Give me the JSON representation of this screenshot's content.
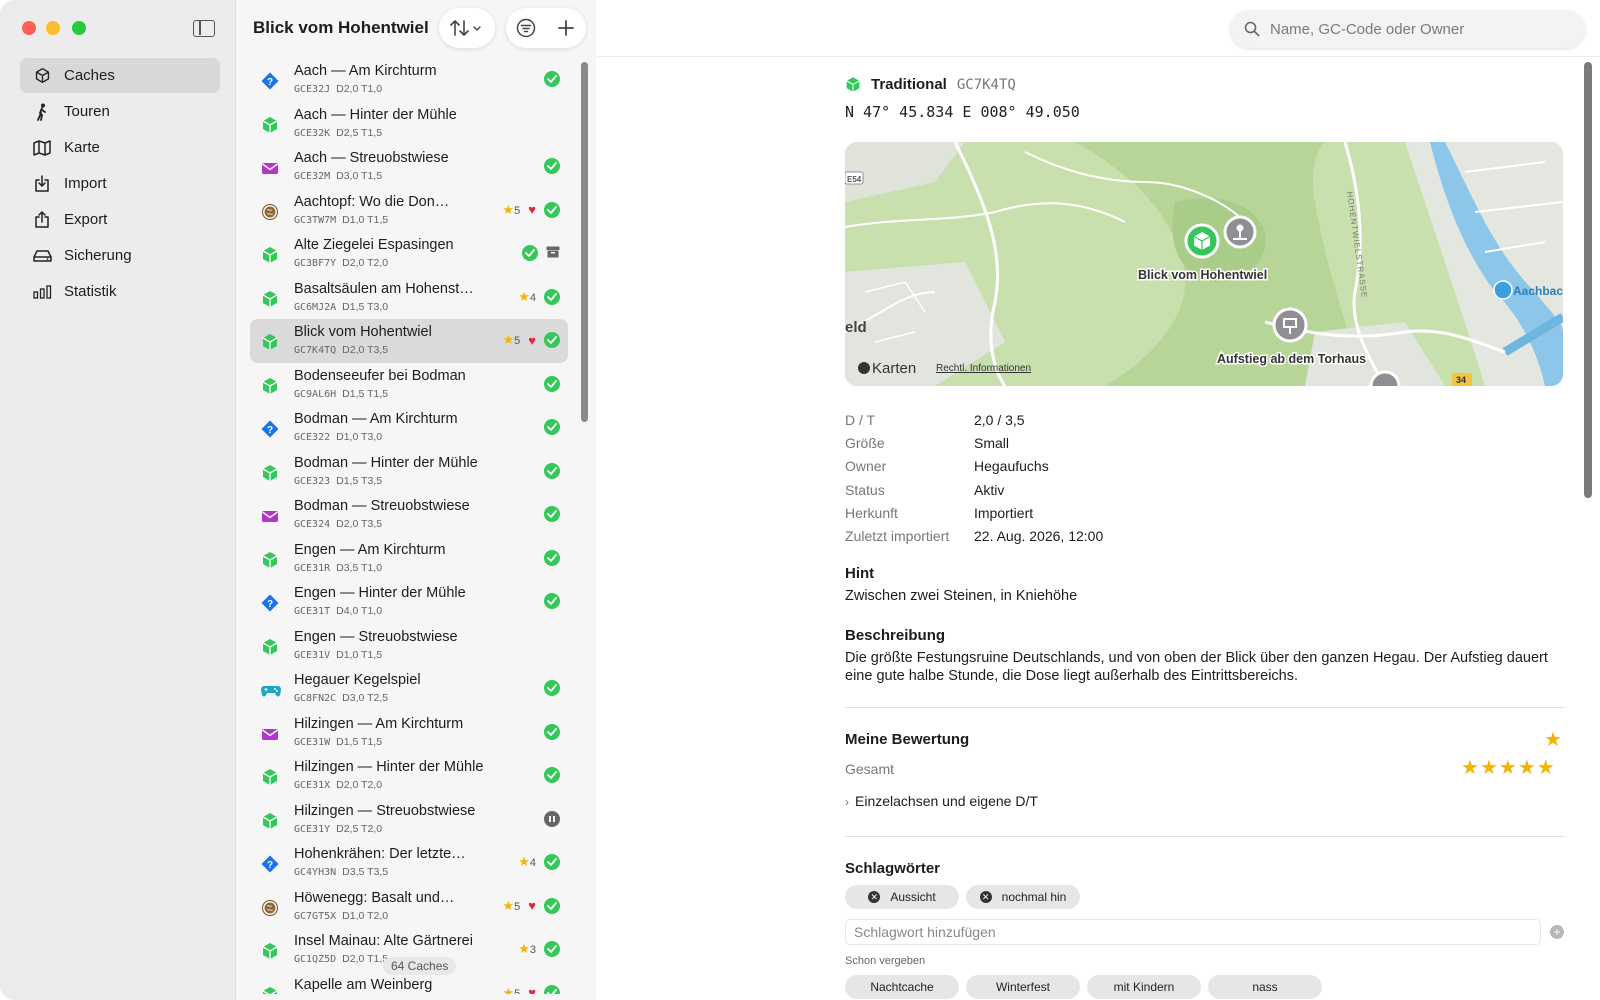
{
  "sidebar": {
    "items": [
      {
        "label": "Caches",
        "icon": "cube-icon"
      },
      {
        "label": "Touren",
        "icon": "hiker-icon"
      },
      {
        "label": "Karte",
        "icon": "map-icon"
      },
      {
        "label": "Import",
        "icon": "import-icon"
      },
      {
        "label": "Export",
        "icon": "export-icon"
      },
      {
        "label": "Sicherung",
        "icon": "drive-icon"
      },
      {
        "label": "Statistik",
        "icon": "chart-icon"
      }
    ]
  },
  "list": {
    "title": "Blick vom Hohentwiel",
    "count_label": "64 Caches",
    "items": [
      {
        "name": "Aach — Am Kirchturm",
        "code": "GCE32J",
        "dt": "D2,0 T1,0",
        "type": "mystery",
        "status": "found"
      },
      {
        "name": "Aach — Hinter der Mühle",
        "code": "GCE32K",
        "dt": "D2,5 T1,5",
        "type": "traditional",
        "status": "none"
      },
      {
        "name": "Aach — Streuobstwiese",
        "code": "GCE32M",
        "dt": "D3,0 T1,5",
        "type": "letterbox",
        "status": "found"
      },
      {
        "name": "Aachtopf: Wo die Don…",
        "code": "GC3TW7M",
        "dt": "D1,0 T1,5",
        "type": "earth",
        "stars": "5",
        "fav": true,
        "status": "found"
      },
      {
        "name": "Alte Ziegelei Espasingen",
        "code": "GC3BF7Y",
        "dt": "D2,0 T2,0",
        "type": "traditional",
        "status": "found",
        "archived": true
      },
      {
        "name": "Basaltsäulen am Hohenst…",
        "code": "GC6MJ2A",
        "dt": "D1,5 T3,0",
        "type": "traditional",
        "stars": "4",
        "status": "found"
      },
      {
        "name": "Blick vom Hohentwiel",
        "code": "GC7K4TQ",
        "dt": "D2,0 T3,5",
        "type": "traditional",
        "stars": "5",
        "fav": true,
        "status": "found",
        "selected": true
      },
      {
        "name": "Bodenseeufer bei Bodman",
        "code": "GC9AL6H",
        "dt": "D1,5 T1,5",
        "type": "traditional",
        "status": "found"
      },
      {
        "name": "Bodman — Am Kirchturm",
        "code": "GCE322",
        "dt": "D1,0 T3,0",
        "type": "mystery",
        "status": "found"
      },
      {
        "name": "Bodman — Hinter der Mühle",
        "code": "GCE323",
        "dt": "D1,5 T3,5",
        "type": "traditional",
        "status": "found"
      },
      {
        "name": "Bodman — Streuobstwiese",
        "code": "GCE324",
        "dt": "D2,0 T3,5",
        "type": "letterbox",
        "status": "found"
      },
      {
        "name": "Engen — Am Kirchturm",
        "code": "GCE31R",
        "dt": "D3,5 T1,0",
        "type": "traditional",
        "status": "found"
      },
      {
        "name": "Engen — Hinter der Mühle",
        "code": "GCE31T",
        "dt": "D4,0 T1,0",
        "type": "mystery",
        "status": "found"
      },
      {
        "name": "Engen — Streuobstwiese",
        "code": "GCE31V",
        "dt": "D1,0 T1,5",
        "type": "traditional",
        "status": "none"
      },
      {
        "name": "Hegauer Kegelspiel",
        "code": "GC8FN2C",
        "dt": "D3,0 T2,5",
        "type": "wherigo",
        "status": "found"
      },
      {
        "name": "Hilzingen — Am Kirchturm",
        "code": "GCE31W",
        "dt": "D1,5 T1,5",
        "type": "letterbox",
        "status": "found"
      },
      {
        "name": "Hilzingen — Hinter der Mühle",
        "code": "GCE31X",
        "dt": "D2,0 T2,0",
        "type": "traditional",
        "status": "found"
      },
      {
        "name": "Hilzingen — Streuobstwiese",
        "code": "GCE31Y",
        "dt": "D2,5 T2,0",
        "type": "traditional",
        "status": "paused"
      },
      {
        "name": "Hohenkrähen: Der letzte…",
        "code": "GC4YH3N",
        "dt": "D3,5 T3,5",
        "type": "mystery",
        "stars": "4",
        "status": "found"
      },
      {
        "name": "Höwenegg: Basalt und…",
        "code": "GC7GT5X",
        "dt": "D1,0 T2,0",
        "type": "earth",
        "stars": "5",
        "fav": true,
        "status": "found"
      },
      {
        "name": "Insel Mainau: Alte Gärtnerei",
        "code": "GC1QZ5D",
        "dt": "D2,0 T1,5",
        "type": "traditional",
        "stars": "3",
        "status": "found"
      },
      {
        "name": "Kapelle am Weinberg",
        "code": "",
        "dt": "",
        "type": "traditional",
        "stars": "5",
        "fav": true,
        "status": "found"
      }
    ]
  },
  "search": {
    "placeholder": "Name, GC-Code oder Owner"
  },
  "detail": {
    "type_label": "Traditional",
    "code": "GC7K4TQ",
    "coords": "N 47° 45.834 E 008° 49.050",
    "map": {
      "label_main": "Blick vom Hohentwiel",
      "label_second": "Aufstieg ab dem Torhaus",
      "label_aachbad": "Aachbac",
      "label_left": "eld",
      "label_road": "HOHENTWIELSTRASSE",
      "label_road_num": "34",
      "label_road_left": "E54",
      "attribution_brand": "Karten",
      "attribution_legal": "Rechtl. Informationen"
    },
    "fields": [
      {
        "key": "D / T",
        "value": "2,0 / 3,5"
      },
      {
        "key": "Größe",
        "value": "Small"
      },
      {
        "key": "Owner",
        "value": "Hegaufuchs"
      },
      {
        "key": "Status",
        "value": "Aktiv"
      },
      {
        "key": "Herkunft",
        "value": "Importiert"
      },
      {
        "key": "Zuletzt importiert",
        "value": "22. Aug. 2026, 12:00"
      }
    ],
    "hint_title": "Hint",
    "hint_text": "Zwischen zwei Steinen, in Kniehöhe",
    "desc_title": "Beschreibung",
    "desc_text": "Die größte Festungsruine Deutschlands, und von oben der Blick über den ganzen Hegau. Der Aufstieg dauert eine gute halbe Stunde, die Dose liegt außerhalb des Eintrittsbereichs.",
    "rating_title": "Meine Bewertung",
    "rating_overall_label": "Gesamt",
    "rating_overall": 5,
    "rating_expand_label": "Einzelachsen und eigene D/T",
    "tags_title": "Schlagwörter",
    "tags": [
      "Aussicht",
      "nochmal hin"
    ],
    "tag_input_placeholder": "Schlagwort hinzufügen",
    "used_title": "Schon vergeben",
    "used_tags": [
      "Nachtcache",
      "Winterfest",
      "mit Kindern",
      "nass"
    ]
  },
  "colors": {
    "traditional": "#34c759",
    "mystery": "#1a73e8",
    "letterbox": "#b336c8",
    "wherigo": "#19a7c9",
    "earth": "#8a6a3a",
    "found": "#34c759",
    "favorite": "#e8263b",
    "star": "#f5b400"
  }
}
